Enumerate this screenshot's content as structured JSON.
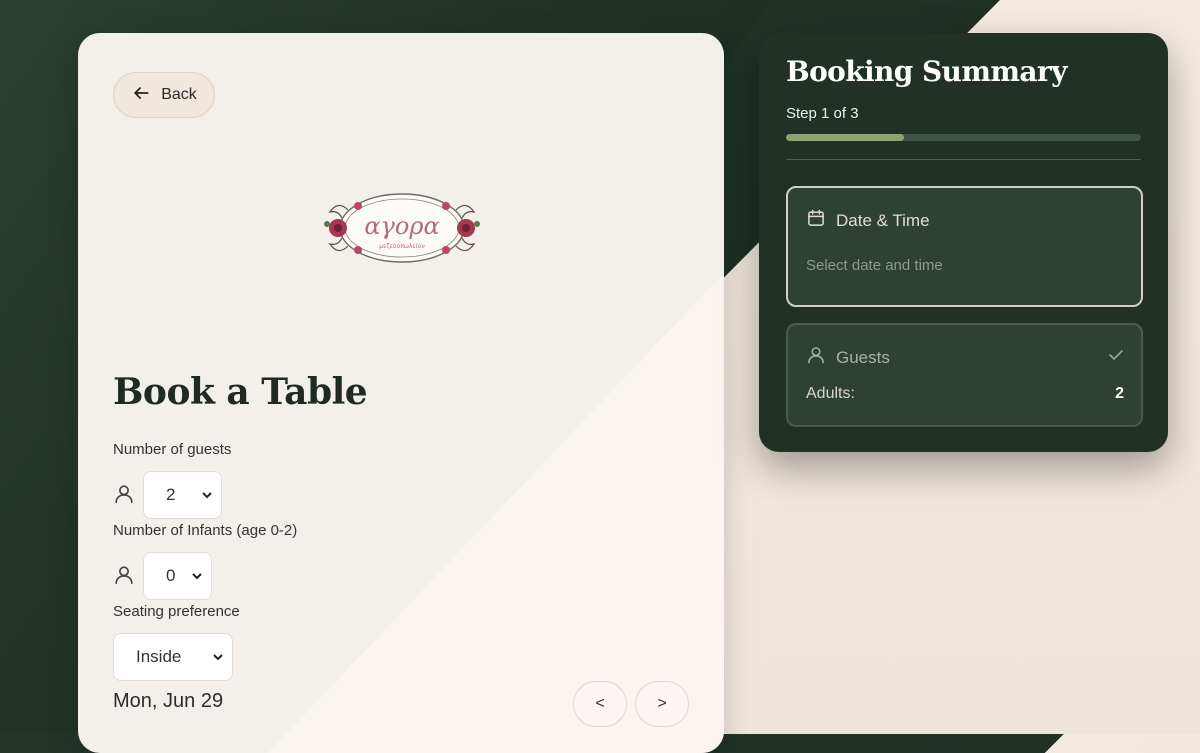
{
  "back": {
    "label": "Back"
  },
  "logo": {
    "text": "αγορα",
    "subtitle": "μεζεδοπωλείον"
  },
  "page": {
    "title": "Book a Table"
  },
  "guests": {
    "label": "Number of guests",
    "value": "2"
  },
  "infants": {
    "label": "Number of Infants (age 0-2)",
    "value": "0"
  },
  "seating": {
    "label": "Seating preference",
    "value": "Inside"
  },
  "date": {
    "text": "Mon, Jun 29",
    "prev_label": "<",
    "next_label": ">"
  },
  "summary": {
    "title": "Booking Summary",
    "step_text": "Step 1 of 3",
    "progress": 0.333,
    "date_time": {
      "heading": "Date & Time",
      "placeholder": "Select date and time"
    },
    "guests_section": {
      "heading": "Guests",
      "adults_label": "Adults:",
      "adults_value": "2"
    }
  },
  "colors": {
    "dark_green": "#213125",
    "accent": "#8ea278",
    "card_light": "#f3efea"
  }
}
